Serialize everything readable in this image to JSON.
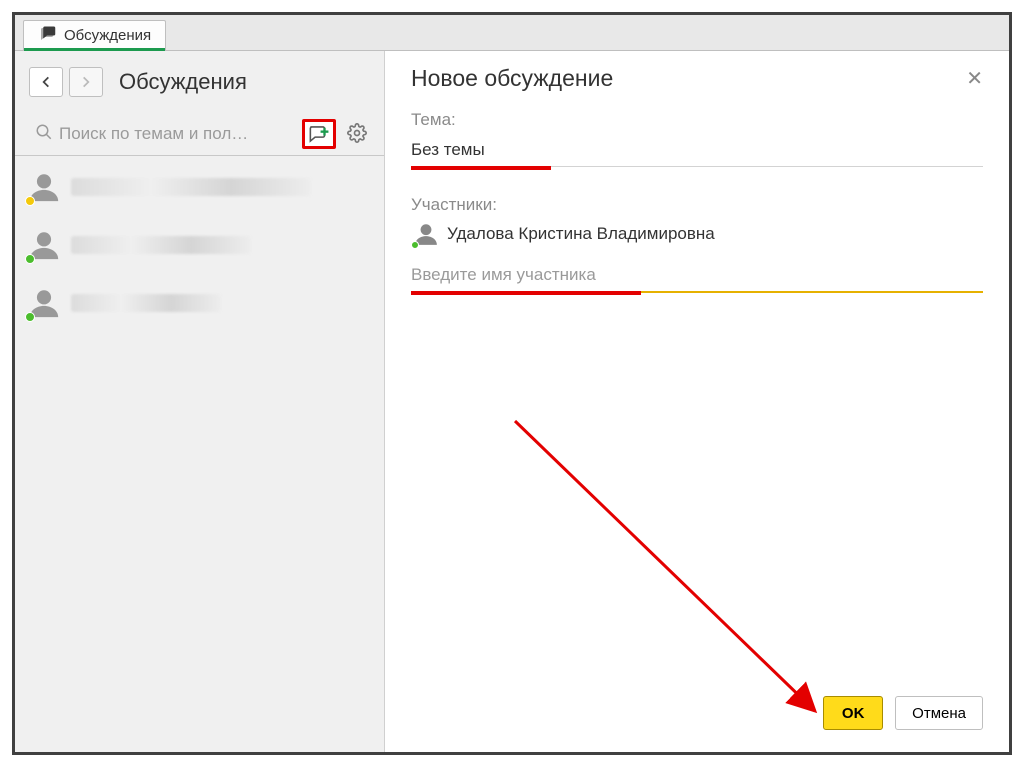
{
  "tab": {
    "label": "Обсуждения"
  },
  "sidebar": {
    "title": "Обсуждения",
    "search_placeholder": "Поиск по темам и пол…",
    "contacts": [
      {
        "presence": "away"
      },
      {
        "presence": "online"
      },
      {
        "presence": "online"
      }
    ]
  },
  "dialog": {
    "title": "Новое обсуждение",
    "topic_label": "Тема:",
    "topic_value": "Без темы",
    "participants_label": "Участники:",
    "participants": [
      {
        "name": "Удалова Кристина Владимировна",
        "presence": "online"
      }
    ],
    "add_participant_placeholder": "Введите имя участника",
    "ok_label": "OK",
    "cancel_label": "Отмена"
  }
}
